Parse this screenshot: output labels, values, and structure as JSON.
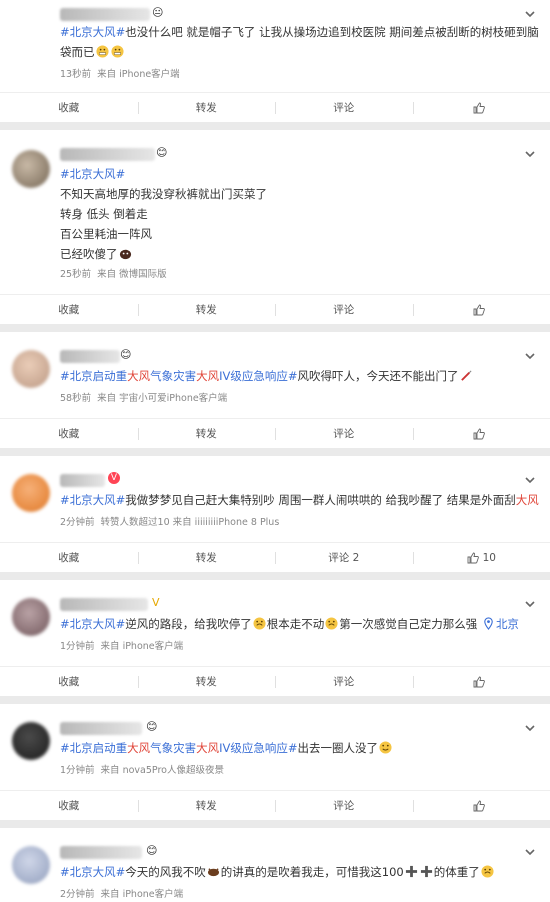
{
  "posts": [
    {
      "lines": [
        [
          {
            "t": "topic",
            "v": "#北京大风#"
          },
          {
            "t": "text",
            "v": "也没什么吧 就是帽子飞了 让我从操场边追到校医院 期间差点被刮断的树枝砸到脑"
          }
        ],
        [
          {
            "t": "text",
            "v": "袋而已"
          }
        ]
      ],
      "time": "13秒前",
      "source": "来自 iPhone客户端",
      "actions": {
        "collect": "收藏",
        "repost": "转发",
        "comment": "评论",
        "like": ""
      }
    },
    {
      "lines": [
        [
          {
            "t": "topic",
            "v": "#北京大风#"
          }
        ],
        [
          {
            "t": "text",
            "v": "不知天高地厚的我没穿秋裤就出门买菜了"
          }
        ],
        [
          {
            "t": "text",
            "v": "转身 低头 倒着走"
          }
        ],
        [
          {
            "t": "text",
            "v": "百公里耗油一阵风"
          }
        ],
        [
          {
            "t": "text",
            "v": "已经吹傻了"
          }
        ]
      ],
      "time": "25秒前",
      "source": "来自 微博国际版",
      "actions": {
        "collect": "收藏",
        "repost": "转发",
        "comment": "评论",
        "like": ""
      }
    },
    {
      "lines": [
        [
          {
            "t": "topic",
            "v": "#北京启动重"
          },
          {
            "t": "kw",
            "v": "大风"
          },
          {
            "t": "topic",
            "v": "气象灾害"
          },
          {
            "t": "kw",
            "v": "大风"
          },
          {
            "t": "topic",
            "v": "IV级应急响应#"
          },
          {
            "t": "text",
            "v": "风吹得吓人，今天还不能出门了"
          }
        ]
      ],
      "time": "58秒前",
      "source": "来自 宇宙小可爱iPhone客户端",
      "actions": {
        "collect": "收藏",
        "repost": "转发",
        "comment": "评论",
        "like": ""
      }
    },
    {
      "lines": [
        [
          {
            "t": "topic",
            "v": "#北京大风#"
          },
          {
            "t": "text",
            "v": "我做梦梦见自己赶大集特别吵 周围一群人闹哄哄的 给我吵醒了 结果是外面刮"
          },
          {
            "t": "kw",
            "v": "大风"
          }
        ]
      ],
      "time": "2分钟前",
      "source": "转赞人数超过10  来自 iiiiiiiiiPhone 8 Plus",
      "actions": {
        "collect": "收藏",
        "repost": "转发",
        "comment": "评论 2",
        "like": "10"
      }
    },
    {
      "lines": [
        [
          {
            "t": "topic",
            "v": "#北京大风#"
          },
          {
            "t": "text",
            "v": "逆风的路段，给我吹停了"
          },
          {
            "t": "text",
            "v": "根本走不动"
          },
          {
            "t": "text",
            "v": "第一次感觉自己定力那么强 "
          },
          {
            "t": "loc",
            "v": "北京"
          }
        ]
      ],
      "time": "1分钟前",
      "source": "来自 iPhone客户端",
      "actions": {
        "collect": "收藏",
        "repost": "转发",
        "comment": "评论",
        "like": ""
      }
    },
    {
      "lines": [
        [
          {
            "t": "topic",
            "v": "#北京启动重"
          },
          {
            "t": "kw",
            "v": "大风"
          },
          {
            "t": "topic",
            "v": "气象灾害"
          },
          {
            "t": "kw",
            "v": "大风"
          },
          {
            "t": "topic",
            "v": "IV级应急响应#"
          },
          {
            "t": "text",
            "v": "出去一圈人没了"
          }
        ]
      ],
      "time": "1分钟前",
      "source": "来自 nova5Pro人像超级夜景",
      "actions": {
        "collect": "收藏",
        "repost": "转发",
        "comment": "评论",
        "like": ""
      }
    },
    {
      "lines": [
        [
          {
            "t": "topic",
            "v": "#北京大风#"
          },
          {
            "t": "text",
            "v": "今天的风我不吹"
          },
          {
            "t": "text",
            "v": "的讲真的是吹着我走，可惜我这100"
          },
          {
            "t": "text",
            "v": "的体重了"
          }
        ]
      ],
      "time": "2分钟前",
      "source": "来自 iPhone客户端",
      "actions": {
        "collect": "",
        "repost": "",
        "comment": "",
        "like": ""
      }
    }
  ],
  "colors": {
    "topic": "#3b6fd6",
    "keyword": "#e0463a",
    "text": "#333333",
    "meta": "#888888",
    "background": "#eaeaea"
  },
  "icons": [
    "chevron-down-icon",
    "thumbs-up-icon",
    "emoji-icon",
    "location-icon",
    "vip-badge-icon"
  ]
}
